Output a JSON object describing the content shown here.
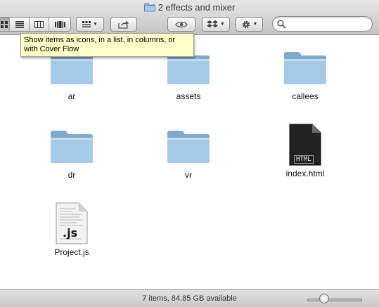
{
  "window": {
    "title": "2 effects and mixer"
  },
  "toolbar": {
    "view_buttons": [
      {
        "name": "icon-view-button",
        "icon": "icon-grid-icon",
        "pressed": true
      },
      {
        "name": "list-view-button",
        "icon": "list-icon",
        "pressed": false
      },
      {
        "name": "column-view-button",
        "icon": "columns-icon",
        "pressed": false
      },
      {
        "name": "cover-flow-button",
        "icon": "cover-flow-icon",
        "pressed": false
      }
    ],
    "arrange_icon": "arrange-grid-icon",
    "share_icon": "share-arrow-icon",
    "quicklook_icon": "eye-icon",
    "dropbox_icon": "dropbox-icon",
    "action_icon": "gear-icon",
    "search": {
      "value": "",
      "placeholder": ""
    }
  },
  "tooltip": {
    "text": "Show items as icons, in a list, in columns, or with Cover Flow"
  },
  "files": [
    {
      "name": "ar",
      "kind": "folder"
    },
    {
      "name": "assets",
      "kind": "folder"
    },
    {
      "name": "callees",
      "kind": "folder"
    },
    {
      "name": "dr",
      "kind": "folder"
    },
    {
      "name": "vr",
      "kind": "folder"
    },
    {
      "name": "index.html",
      "kind": "html-file",
      "badge": "HTML"
    },
    {
      "name": "Project.js",
      "kind": "js-file",
      "badge": ".js"
    }
  ],
  "status": {
    "text": "7 items, 84.85 GB available",
    "zoom_level": 0.27
  },
  "colors": {
    "folder": "#9fc3e0",
    "tooltip_bg": "#fefec8",
    "html_icon": "#2a2a2a"
  }
}
